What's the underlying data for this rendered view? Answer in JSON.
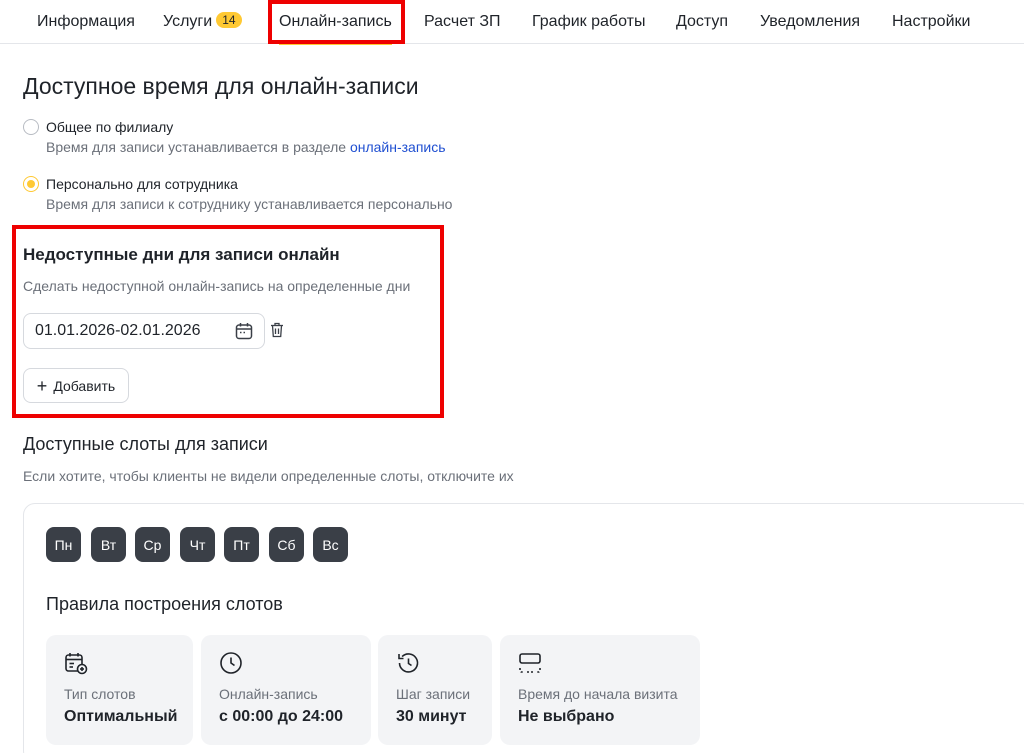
{
  "tabs": [
    {
      "label": "Информация"
    },
    {
      "label": "Услуги",
      "badge": "14"
    },
    {
      "label": "Онлайн-запись"
    },
    {
      "label": "Расчет ЗП"
    },
    {
      "label": "График работы"
    },
    {
      "label": "Доступ"
    },
    {
      "label": "Уведомления"
    },
    {
      "label": "Настройки"
    }
  ],
  "available_time": {
    "title": "Доступное время для онлайн-записи",
    "options": [
      {
        "label": "Общее по филиалу",
        "hint_prefix": "Время для записи устанавливается в разделе ",
        "hint_link": "онлайн-запись",
        "checked": false
      },
      {
        "label": "Персонально для сотрудника",
        "hint": "Время для записи к сотруднику устанавливается персонально",
        "checked": true
      }
    ]
  },
  "unavailable_days": {
    "title": "Недоступные дни для записи онлайн",
    "hint": "Сделать недоступной онлайн-запись на определенные дни",
    "date_range": "01.01.2026-02.01.2026",
    "add_label": "Добавить"
  },
  "slots": {
    "title": "Доступные слоты для записи",
    "hint": "Если хотите, чтобы клиенты не видели определенные слоты, отключите их",
    "days": [
      "Пн",
      "Вт",
      "Ср",
      "Чт",
      "Пт",
      "Сб",
      "Вс"
    ],
    "rules_title": "Правила построения слотов",
    "rules": [
      {
        "label": "Тип слотов",
        "value": "Оптимальный",
        "icon": "calendar-settings-icon"
      },
      {
        "label": "Онлайн-запись",
        "value": "с 00:00 до 24:00",
        "icon": "clock-icon"
      },
      {
        "label": "Шаг записи",
        "value": "30 минут",
        "icon": "history-icon"
      },
      {
        "label": "Время до начала визита",
        "value": "Не выбрано",
        "icon": "frame-icon"
      }
    ]
  },
  "colors": {
    "accent": "#ffc933",
    "highlight": "#ee0000",
    "link": "#1f4fd1",
    "day_chip": "#3a3f47"
  }
}
